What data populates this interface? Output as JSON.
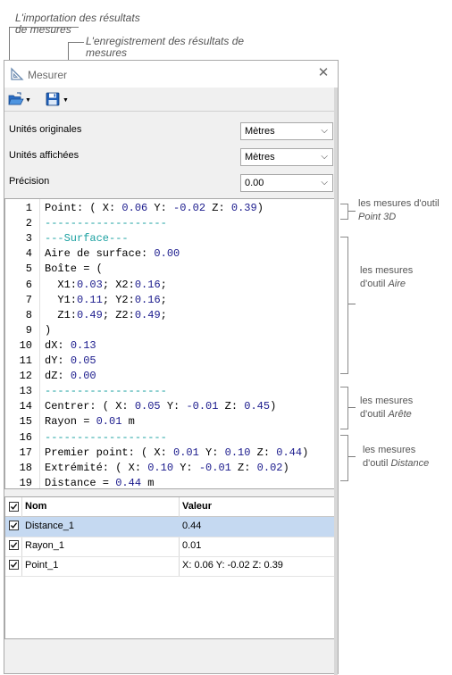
{
  "callouts": {
    "import_line1": "L'importation des résultats",
    "import_line2": "de mesures",
    "save_line1": "L'enregistrement  des résultats de",
    "save_line2": "mesures"
  },
  "side_notes": [
    {
      "line1": "les mesures d'outil",
      "line2": "Point 3D"
    },
    {
      "line1": "les mesures",
      "line2_plain": "d'outil ",
      "line2_em": "Aire"
    },
    {
      "line1": "les mesures",
      "line2_plain": "d'outil ",
      "line2_em": "Arête"
    },
    {
      "line1": "les mesures",
      "line2_plain": "d'outil ",
      "line2_em": "Distance"
    }
  ],
  "window": {
    "title": "Mesurer",
    "close_glyph": "✕"
  },
  "toolbar": {
    "open_arrow": "▼",
    "save_arrow": "▼"
  },
  "params": {
    "original_units": {
      "label": "Unités originales",
      "value": "Mètres"
    },
    "display_units": {
      "label": "Unités affichées",
      "value": "Mètres"
    },
    "precision": {
      "label": "Précision",
      "value": "0.00"
    },
    "chevron": "⌵"
  },
  "results": [
    {
      "n": "1",
      "parts": [
        [
          "",
          "Point: ( X: "
        ],
        [
          "v",
          "0.06"
        ],
        [
          "",
          " Y: "
        ],
        [
          "v",
          "-0.02"
        ],
        [
          "",
          " Z: "
        ],
        [
          "v",
          "0.39"
        ],
        [
          "",
          ")"
        ]
      ]
    },
    {
      "n": "2",
      "parts": [
        [
          "d",
          "-------------------"
        ]
      ]
    },
    {
      "n": "3",
      "parts": [
        [
          "d",
          "---Surface---"
        ]
      ]
    },
    {
      "n": "4",
      "parts": [
        [
          "",
          "Aire de surface: "
        ],
        [
          "v",
          "0.00"
        ]
      ]
    },
    {
      "n": "5",
      "parts": [
        [
          "",
          "Boîte = ("
        ]
      ]
    },
    {
      "n": "6",
      "parts": [
        [
          "",
          "  X1:"
        ],
        [
          "v",
          "0.03"
        ],
        [
          "",
          "; X2:"
        ],
        [
          "v",
          "0.16"
        ],
        [
          "",
          ";"
        ]
      ]
    },
    {
      "n": "7",
      "parts": [
        [
          "",
          "  Y1:"
        ],
        [
          "v",
          "0.11"
        ],
        [
          "",
          "; Y2:"
        ],
        [
          "v",
          "0.16"
        ],
        [
          "",
          ";"
        ]
      ]
    },
    {
      "n": "8",
      "parts": [
        [
          "",
          "  Z1:"
        ],
        [
          "v",
          "0.49"
        ],
        [
          "",
          "; Z2:"
        ],
        [
          "v",
          "0.49"
        ],
        [
          "",
          ";"
        ]
      ]
    },
    {
      "n": "9",
      "parts": [
        [
          "",
          ")"
        ]
      ]
    },
    {
      "n": "10",
      "parts": [
        [
          "",
          "dX: "
        ],
        [
          "v",
          "0.13"
        ]
      ]
    },
    {
      "n": "11",
      "parts": [
        [
          "",
          "dY: "
        ],
        [
          "v",
          "0.05"
        ]
      ]
    },
    {
      "n": "12",
      "parts": [
        [
          "",
          "dZ: "
        ],
        [
          "v",
          "0.00"
        ]
      ]
    },
    {
      "n": "13",
      "parts": [
        [
          "d",
          "-------------------"
        ]
      ]
    },
    {
      "n": "14",
      "parts": [
        [
          "",
          "Centrer: ( X: "
        ],
        [
          "v",
          "0.05"
        ],
        [
          "",
          " Y: "
        ],
        [
          "v",
          "-0.01"
        ],
        [
          "",
          " Z: "
        ],
        [
          "v",
          "0.45"
        ],
        [
          "",
          ")"
        ]
      ]
    },
    {
      "n": "15",
      "parts": [
        [
          "",
          "Rayon = "
        ],
        [
          "v",
          "0.01"
        ],
        [
          "",
          " m"
        ]
      ]
    },
    {
      "n": "16",
      "parts": [
        [
          "d",
          "-------------------"
        ]
      ]
    },
    {
      "n": "17",
      "parts": [
        [
          "",
          "Premier point: ( X: "
        ],
        [
          "v",
          "0.01"
        ],
        [
          "",
          " Y: "
        ],
        [
          "v",
          "0.10"
        ],
        [
          "",
          " Z: "
        ],
        [
          "v",
          "0.44"
        ],
        [
          "",
          ")"
        ]
      ]
    },
    {
      "n": "18",
      "parts": [
        [
          "",
          "Extrémité: ( X: "
        ],
        [
          "v",
          "0.10"
        ],
        [
          "",
          " Y: "
        ],
        [
          "v",
          "-0.01"
        ],
        [
          "",
          " Z: "
        ],
        [
          "v",
          "0.02"
        ],
        [
          "",
          ")"
        ]
      ]
    },
    {
      "n": "19",
      "parts": [
        [
          "",
          "Distance = "
        ],
        [
          "v",
          "0.44"
        ],
        [
          "",
          " m"
        ]
      ]
    }
  ],
  "grid": {
    "headers": {
      "name": "Nom",
      "value": "Valeur"
    },
    "rows": [
      {
        "name": "Distance_1",
        "value": "0.44",
        "checked": true,
        "selected": true
      },
      {
        "name": "Rayon_1",
        "value": "0.01",
        "checked": true,
        "selected": false
      },
      {
        "name": "Point_1",
        "value": "X: 0.06 Y: -0.02 Z: 0.39",
        "checked": true,
        "selected": false
      }
    ]
  },
  "colors": {
    "value_blue": "#1a1a8c",
    "dash_teal": "#1aa0a0",
    "selection": "#c5d9f1"
  }
}
